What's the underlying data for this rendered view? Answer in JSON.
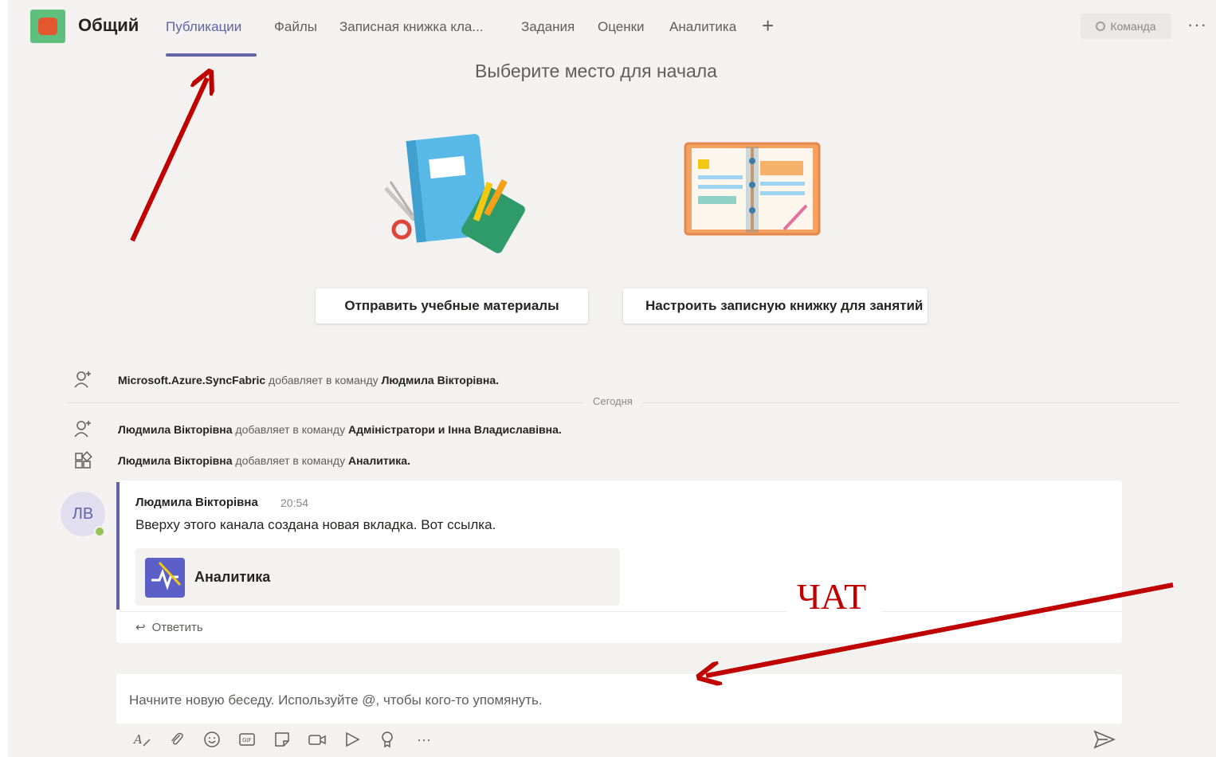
{
  "header": {
    "channel_title": "Общий",
    "tabs": [
      {
        "label": "Публикации",
        "active": true
      },
      {
        "label": "Файлы",
        "active": false
      },
      {
        "label": "Записная книжка кла...",
        "active": false
      },
      {
        "label": "Задания",
        "active": false
      },
      {
        "label": "Оценки",
        "active": false
      },
      {
        "label": "Аналитика",
        "active": false
      }
    ],
    "add_tab_icon": "plus-icon",
    "team_button_label": "Команда",
    "more_icon": "ellipsis-icon"
  },
  "welcome": {
    "title": "Выберите место для начала",
    "send_materials_button": "Отправить учебные материалы",
    "setup_notebook_button": "Настроить записную книжку для занятий"
  },
  "activity": {
    "items": [
      {
        "icon": "person-add-icon",
        "actor": "Microsoft.Azure.SyncFabric",
        "action": " добавляет в команду ",
        "target": "Людмила Вікторівна."
      },
      {
        "icon": "person-add-icon",
        "actor": "Людмила Вікторівна",
        "action": " добавляет в команду ",
        "target": "Адміністратори и Інна Владиславівна."
      },
      {
        "icon": "apps-add-icon",
        "actor": "Людмила Вікторівна",
        "action": " добавляет в команду ",
        "target": "Аналитика."
      }
    ],
    "divider_label": "Сегодня"
  },
  "message": {
    "avatar_initials": "ЛВ",
    "author": "Людмила Вікторівна",
    "time": "20:54",
    "body": "Вверху этого канала создана новая вкладка. Вот ссылка.",
    "link_title": "Аналитика",
    "reply_label": "Ответить"
  },
  "compose": {
    "placeholder": "Начните новую беседу. Используйте @, чтобы кого-то упомянуть.",
    "toolbar_icons": [
      "format-icon",
      "attach-icon",
      "emoji-icon",
      "gif-icon",
      "sticker-icon",
      "meet-now-icon",
      "stream-icon",
      "praise-icon",
      "more-options-icon"
    ],
    "send_icon": "send-icon"
  },
  "annotation": {
    "chat_label": "ЧАТ",
    "arrow_color": "#c00000"
  },
  "colors": {
    "accent": "#6264a7",
    "background": "#f3f2f1",
    "presence": "#92c353"
  }
}
